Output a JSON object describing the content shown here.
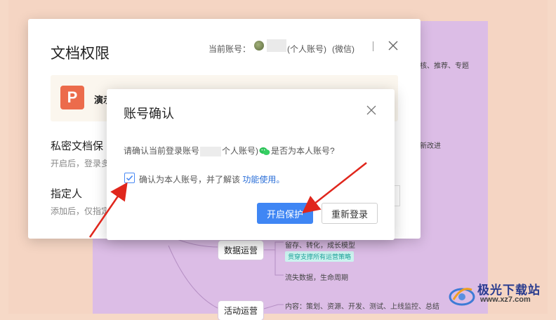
{
  "mindmap": {
    "snippets": [
      "核、推荐、专题",
      "新改进",
      "留存、转化，成长模型",
      "流失数据，生命周期",
      "内容：策划、资源、开发、测试、上线监控、总结"
    ],
    "nodes": [
      "数据运营",
      "活动运营"
    ],
    "tag": "贯穿支撑所有运营策略"
  },
  "watermark": {
    "title": "极光下载站",
    "url": "www.xz7.com"
  },
  "permission_dialog": {
    "title": "文档权限",
    "account_label": "当前账号：",
    "account_type": "(个人账号)",
    "account_via": "(微信)",
    "file_icon_letter": "P",
    "file_name": "演示",
    "private_title": "私密文档保",
    "private_desc": "开启后，登录多",
    "assign_title": "指定人",
    "assign_desc": "添加后，仅指定"
  },
  "confirm_dialog": {
    "title": "账号确认",
    "question_pre": "请确认当前登录账号",
    "question_mid": "个人账号)",
    "question_post": "是否为本人账号?",
    "checkbox_checked": true,
    "checkbox_label": "确认为本人账号，并了解该",
    "checkbox_link": "功能使用。",
    "primary_button": "开启保护",
    "secondary_button": "重新登录"
  },
  "colors": {
    "primary": "#3f86f4",
    "arrow": "#e0261c",
    "ppt": "#ec6b4b",
    "mindmap_bg": "#dcbde6"
  }
}
